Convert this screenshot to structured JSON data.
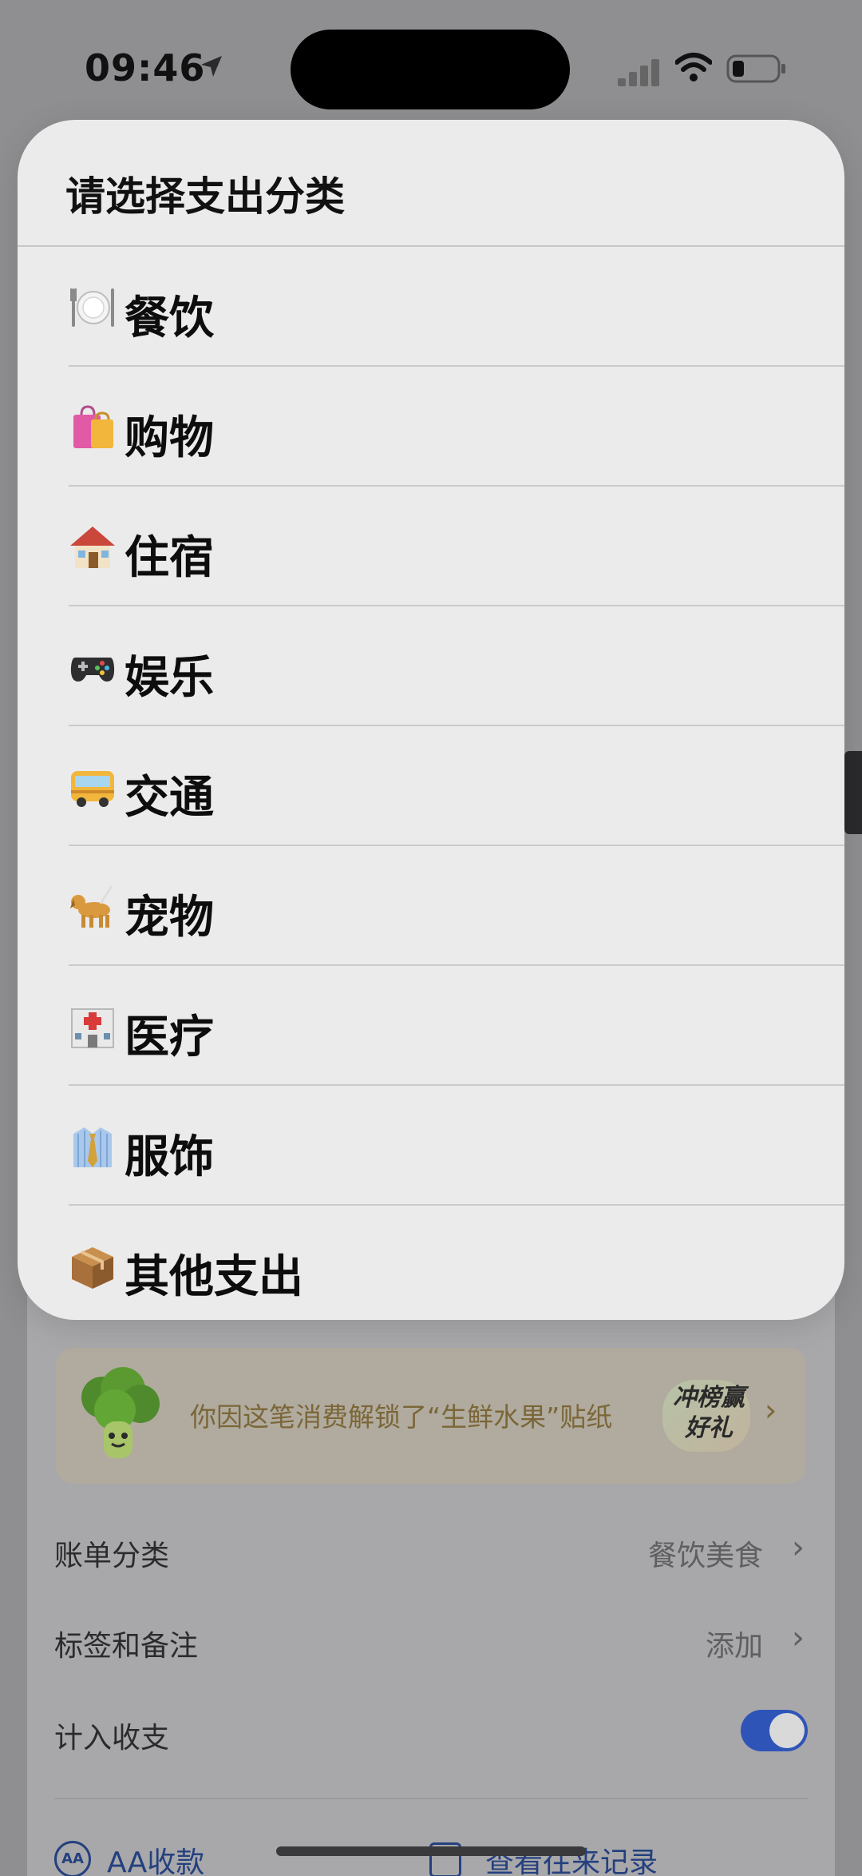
{
  "status_bar": {
    "time": "09:46"
  },
  "sheet": {
    "title": "请选择支出分类",
    "categories": [
      {
        "label": "餐饮",
        "icon": "plate-cutlery-icon"
      },
      {
        "label": "购物",
        "icon": "shopping-bags-icon"
      },
      {
        "label": "住宿",
        "icon": "house-icon"
      },
      {
        "label": "娱乐",
        "icon": "game-controller-icon"
      },
      {
        "label": "交通",
        "icon": "bus-icon"
      },
      {
        "label": "宠物",
        "icon": "dog-icon"
      },
      {
        "label": "医疗",
        "icon": "hospital-icon"
      },
      {
        "label": "服饰",
        "icon": "shirt-tie-icon"
      },
      {
        "label": "其他支出",
        "icon": "package-box-icon"
      }
    ]
  },
  "background": {
    "sticker_banner": {
      "text": "你因这笔消费解锁了“生鲜水果”贴纸",
      "badge": "冲榜赢好礼"
    },
    "settings": {
      "bill_category_label": "账单分类",
      "bill_category_value": "餐饮美食",
      "tags_label": "标签和备注",
      "tags_value": "添加",
      "include_label": "计入收支",
      "include_on": true
    },
    "actions": {
      "aa_label": "AA收款",
      "aa_icon_text": "AA",
      "history_label": "查看往来记录"
    }
  },
  "colors": {
    "sheet_bg": "#ebebeb",
    "dim_bg": "#8f8f92",
    "toggle_on": "#2f54b8",
    "link_blue": "#24407f",
    "sticker_text": "#7b6638"
  }
}
